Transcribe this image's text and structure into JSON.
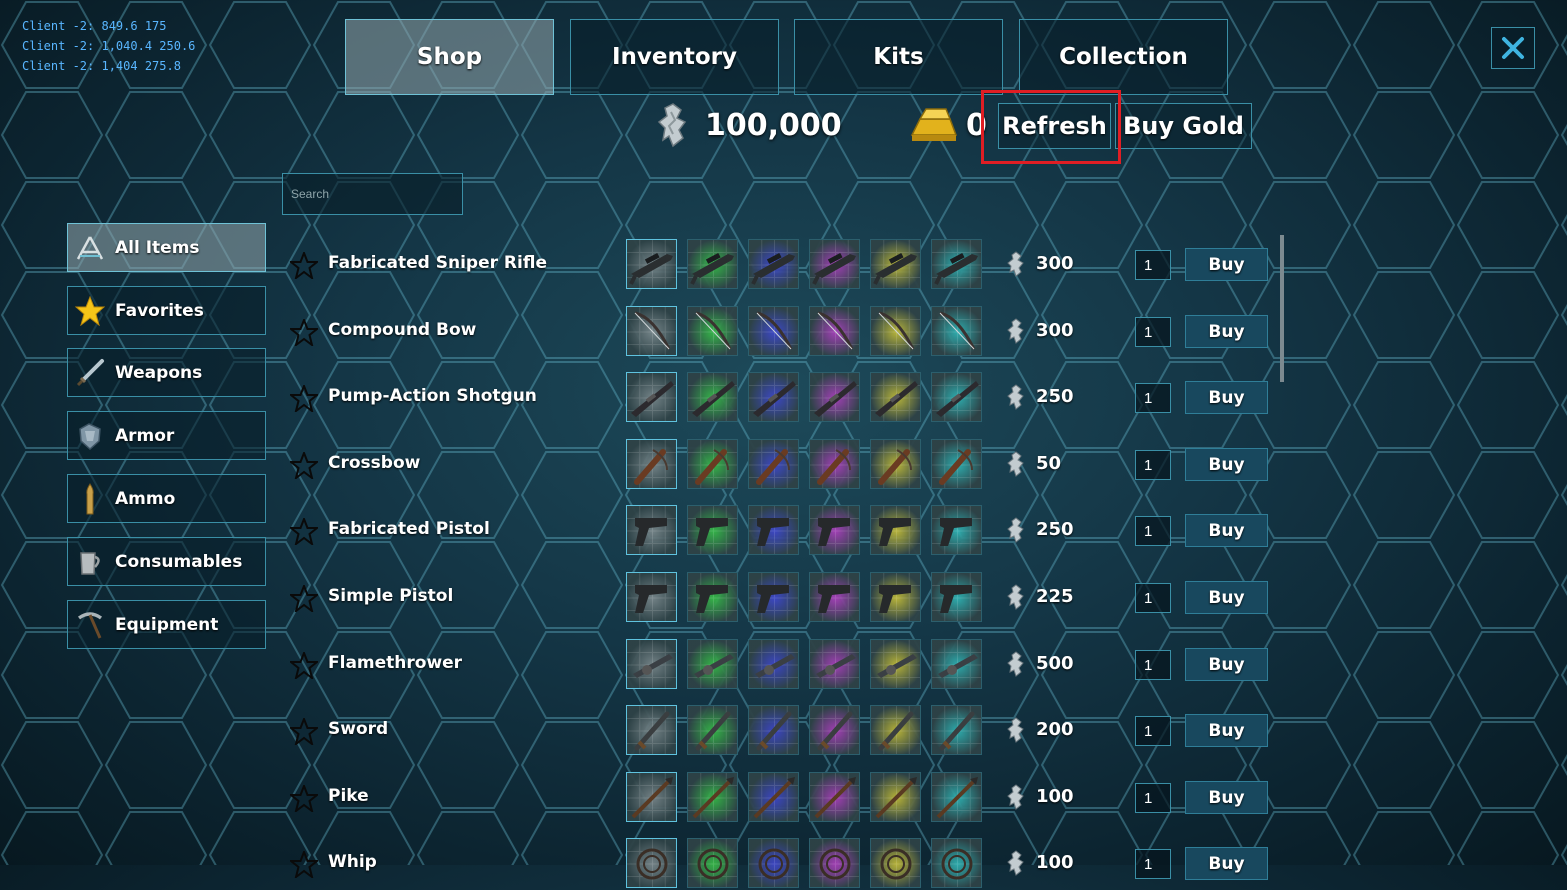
{
  "debug_lines": [
    "Client -2: 849.6 175",
    "Client -2: 1,040.4 250.6",
    "Client -2: 1,404 275.8"
  ],
  "tabs": [
    {
      "label": "Shop",
      "active": true
    },
    {
      "label": "Inventory",
      "active": false
    },
    {
      "label": "Kits",
      "active": false
    },
    {
      "label": "Collection",
      "active": false
    }
  ],
  "currency": {
    "points": "100,000",
    "gold": "0"
  },
  "buttons": {
    "refresh": "Refresh",
    "buy_gold": "Buy  Gold"
  },
  "search": {
    "placeholder": "Search"
  },
  "categories": [
    {
      "label": "All  Items",
      "icon": "ark-logo-icon",
      "active": true
    },
    {
      "label": "Favorites",
      "icon": "star-icon",
      "active": false
    },
    {
      "label": "Weapons",
      "icon": "sword-icon",
      "active": false
    },
    {
      "label": "Armor",
      "icon": "armor-icon",
      "active": false
    },
    {
      "label": "Ammo",
      "icon": "bullet-icon",
      "active": false
    },
    {
      "label": "Consumables",
      "icon": "mug-icon",
      "active": false
    },
    {
      "label": "Equipment",
      "icon": "pickaxe-icon",
      "active": false
    }
  ],
  "items": [
    {
      "name": "Fabricated  Sniper  Rifle",
      "price": "300",
      "qty": "1",
      "buy": "Buy",
      "icon": "rifle-icon"
    },
    {
      "name": "Compound  Bow",
      "price": "300",
      "qty": "1",
      "buy": "Buy",
      "icon": "bow-icon"
    },
    {
      "name": "Pump-Action  Shotgun",
      "price": "250",
      "qty": "1",
      "buy": "Buy",
      "icon": "shotgun-icon"
    },
    {
      "name": "Crossbow",
      "price": "50",
      "qty": "1",
      "buy": "Buy",
      "icon": "crossbow-icon"
    },
    {
      "name": "Fabricated  Pistol",
      "price": "250",
      "qty": "1",
      "buy": "Buy",
      "icon": "pistol-icon"
    },
    {
      "name": "Simple  Pistol",
      "price": "225",
      "qty": "1",
      "buy": "Buy",
      "icon": "pistol-icon"
    },
    {
      "name": "Flamethrower",
      "price": "500",
      "qty": "1",
      "buy": "Buy",
      "icon": "flamethrower-icon"
    },
    {
      "name": "Sword",
      "price": "200",
      "qty": "1",
      "buy": "Buy",
      "icon": "sword-icon"
    },
    {
      "name": "Pike",
      "price": "100",
      "qty": "1",
      "buy": "Buy",
      "icon": "pike-icon"
    },
    {
      "name": "Whip",
      "price": "100",
      "qty": "1",
      "buy": "Buy",
      "icon": "whip-icon"
    }
  ],
  "skin_colors": [
    "#7d8a8d",
    "#38c048",
    "#4048d0",
    "#b040c0",
    "#c8c038",
    "#30b8b8"
  ],
  "colors": {
    "accent_border": "#3a8fa6",
    "highlight": "#e01e24",
    "debug_text": "#59b6ff"
  }
}
